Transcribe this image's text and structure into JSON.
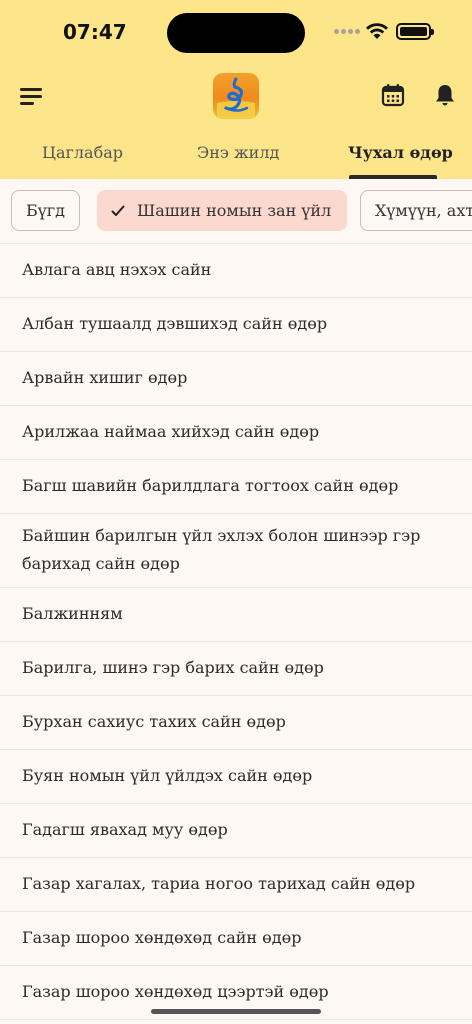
{
  "status_bar": {
    "time": "07:47"
  },
  "tabs": [
    {
      "label": "Цаглабар"
    },
    {
      "label": "Энэ жилд"
    },
    {
      "label": "Чухал өдөр"
    }
  ],
  "filters": [
    {
      "label": "Бүгд"
    },
    {
      "label": "Шашин номын зан үйл"
    },
    {
      "label": "Хүмүүн, ахт"
    }
  ],
  "items": [
    "Авлага авц нэхэх сайн",
    "Албан тушаалд дэвшихэд сайн өдөр",
    "Арвайн хишиг өдөр",
    "Арилжаа наймаа хийхэд сайн өдөр",
    "Багш шавийн барилдлага тогтоох сайн өдөр",
    "Байшин барилгын үйл эхлэх болон шинээр гэр барихад сайн өдөр",
    "Балжинням",
    "Барилга, шинэ гэр барих сайн өдөр",
    "Бурхан сахиус тахих сайн өдөр",
    "Буян номын үйл үйлдэх сайн өдөр",
    "Гадагш явахад муу өдөр",
    "Газар хагалах, тариа ногоо тарихад сайн өдөр",
    "Газар шороо хөндөхөд сайн өдөр",
    "Газар шороо хөндөхөд цээртэй өдөр"
  ]
}
